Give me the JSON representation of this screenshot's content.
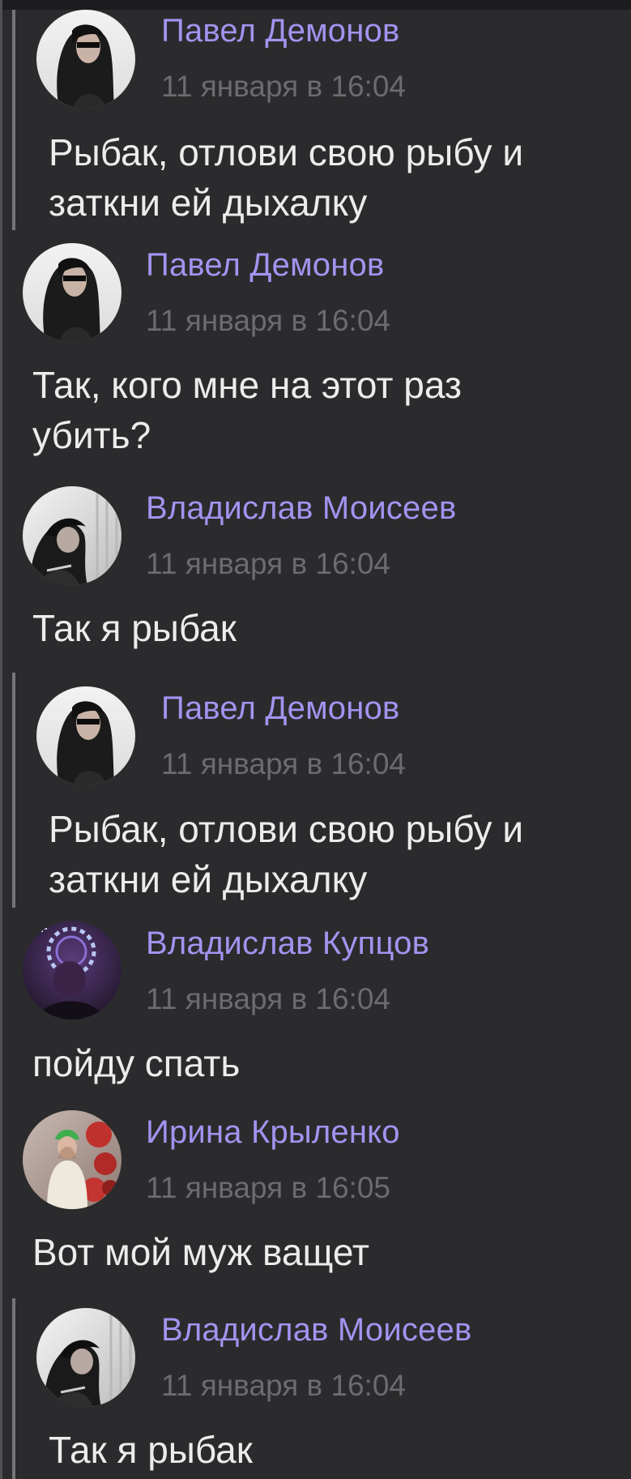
{
  "messages": [
    {
      "author": "Павел Демонов",
      "time": "11 января в 16:04",
      "lines": [
        "Рыбак, отлови свою рыбу и",
        "заткни ей дыхалку"
      ],
      "avatar_icon": "long-hair-sunglasses-avatar",
      "quoted": true
    },
    {
      "author": "Павел Демонов",
      "time": "11 января в 16:04",
      "lines": [
        "Так, кого мне на этот раз",
        "убить?"
      ],
      "avatar_icon": "long-hair-sunglasses-avatar",
      "quoted": false
    },
    {
      "author": "Владислав Моисеев",
      "time": "11 января в 16:04",
      "lines": [
        "Так я рыбак"
      ],
      "avatar_icon": "hooded-profile-avatar",
      "quoted": false
    },
    {
      "author": "Павел Демонов",
      "time": "11 января в 16:04",
      "lines": [
        "Рыбак, отлови свою рыбу и",
        "заткни ей дыхалку"
      ],
      "avatar_icon": "long-hair-sunglasses-avatar",
      "quoted": true
    },
    {
      "author": "Владислав Купцов",
      "time": "11 января в 16:04",
      "lines": [
        "пойду спать"
      ],
      "avatar_icon": "purple-neon-avatar",
      "quoted": false
    },
    {
      "author": "Ирина Крыленко",
      "time": "11 января в 16:05",
      "lines": [
        "Вот мой муж ващет"
      ],
      "avatar_icon": "woman-green-hat-avatar",
      "quoted": false
    },
    {
      "author": "Владислав Моисеев",
      "time": "11 января в 16:04",
      "lines": [
        "Так я рыбак"
      ],
      "avatar_icon": "hooded-profile-avatar",
      "quoted": true
    }
  ],
  "colors": {
    "background": "#2b2b2d",
    "author": "#a493f0",
    "time": "#6b6b70",
    "text": "#ececec",
    "quote_bar": "#75757a"
  }
}
